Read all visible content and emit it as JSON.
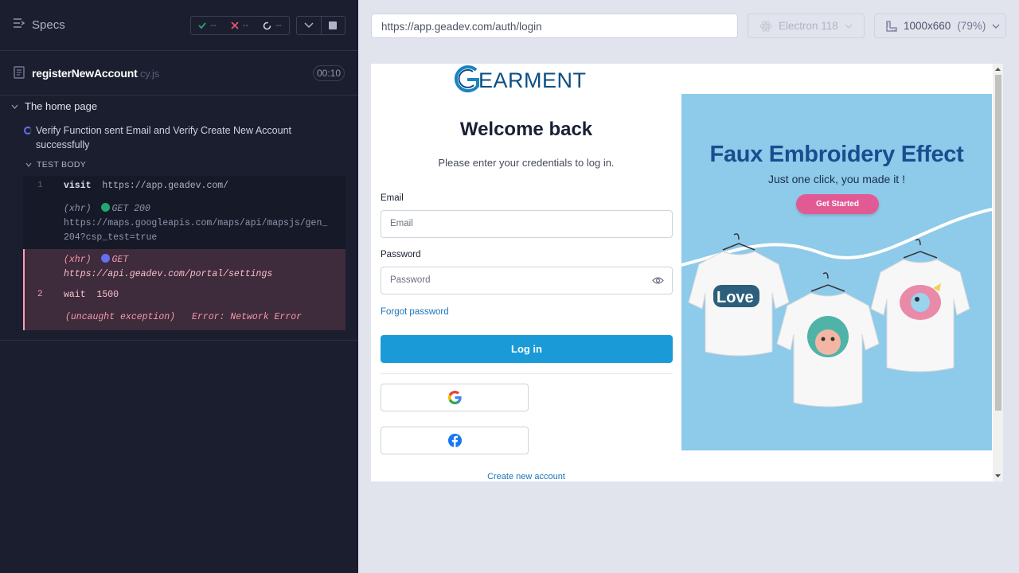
{
  "reporter": {
    "specs_label": "Specs",
    "stats": {
      "passed": "--",
      "failed": "--",
      "pending": "--"
    },
    "spec_file": {
      "name": "registerNewAccount",
      "ext": ".cy.js",
      "duration": "00:10"
    },
    "suite_title": "The home page",
    "test_title": "Verify Function sent Email and Verify Create New Account successfully",
    "body_label": "TEST BODY",
    "commands": {
      "c1": {
        "num": "1",
        "name": "visit",
        "message": "https://app.geadev.com/"
      },
      "x1": {
        "type": "(xhr)",
        "method": "GET 200",
        "url1": "https://maps.googleapis.com/maps/api/mapsjs/gen_",
        "url2": "204?csp_test=true"
      },
      "x2": {
        "type": "(xhr)",
        "method": "GET",
        "url": "https://api.geadev.com/portal/settings"
      },
      "c2": {
        "num": "2",
        "name": "wait",
        "message": "1500"
      },
      "error": {
        "label": "(uncaught exception)",
        "message": "Error: Network Error"
      }
    }
  },
  "toolbar": {
    "url": "https://app.geadev.com/auth/login",
    "browser": "Electron 118",
    "viewport": "1000x660",
    "zoom": "(79%)"
  },
  "app": {
    "logo_text": "EARMENT",
    "welcome": "Welcome back",
    "subtitle": "Please enter your credentials to log in.",
    "email_label": "Email",
    "email_placeholder": "Email",
    "password_label": "Password",
    "password_placeholder": "Password",
    "forgot": "Forgot password",
    "login_button": "Log in",
    "create_account": "Create new account",
    "banner": {
      "title": "Faux Embroidery Effect",
      "subtitle": "Just one click, you made it !",
      "cta": "Get Started",
      "shirt_text": "Love"
    }
  },
  "colors": {
    "reporter_bg": "#1b1e2e",
    "accent_blue": "#1a9ad6",
    "banner_bg": "#8ecaea",
    "error_pink": "#f59aa9",
    "pass_green": "#1fa971",
    "pending_purple": "#6470f3"
  }
}
